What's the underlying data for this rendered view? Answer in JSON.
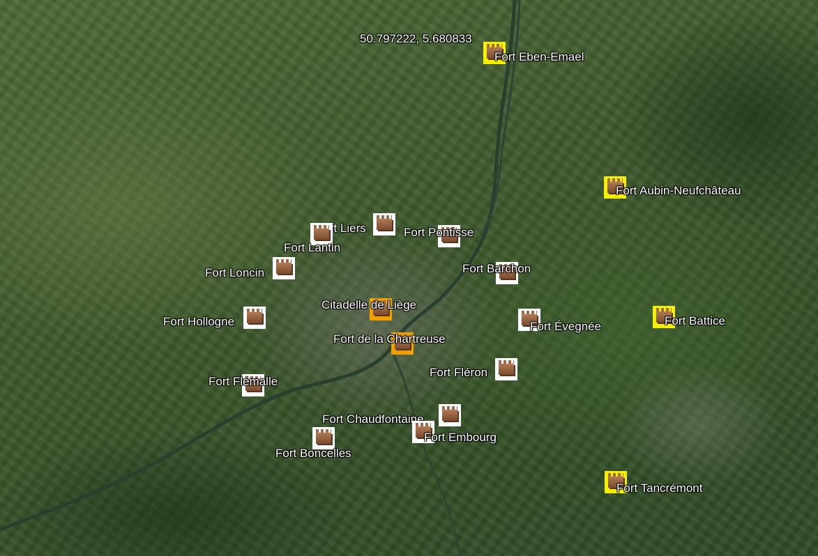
{
  "map": {
    "type": "satellite",
    "coordinate_readout": "50.797222, 5.680833"
  },
  "colors": {
    "fort_icon_white": "#ffffff",
    "fort_icon_yellow": "#f5f000",
    "fort_icon_orange": "#f0a000",
    "label": "#ffffff"
  },
  "placemarks": [
    {
      "name": "Fort Eben-Emael",
      "icon": "fort-icon",
      "style": "yellow"
    },
    {
      "name": "Fort Aubin-Neufchâteau",
      "icon": "fort-icon",
      "style": "yellow"
    },
    {
      "name": "Fort Liers",
      "icon": "fort-icon",
      "style": "white"
    },
    {
      "name": "Fort Pontisse",
      "icon": "fort-icon",
      "style": "white"
    },
    {
      "name": "Fort Lantin",
      "icon": "fort-icon",
      "style": "white"
    },
    {
      "name": "Fort Loncin",
      "icon": "fort-icon",
      "style": "white"
    },
    {
      "name": "Fort Barchon",
      "icon": "fort-icon",
      "style": "white"
    },
    {
      "name": "Citadelle de Liège",
      "icon": "fort-icon",
      "style": "orange"
    },
    {
      "name": "Fort Hollogne",
      "icon": "fort-icon",
      "style": "white"
    },
    {
      "name": "Fort Évegnée",
      "icon": "fort-icon",
      "style": "white"
    },
    {
      "name": "Fort Battice",
      "icon": "fort-icon",
      "style": "yellow"
    },
    {
      "name": "Fort de la Chartreuse",
      "icon": "fort-icon",
      "style": "orange"
    },
    {
      "name": "Fort Fléron",
      "icon": "fort-icon",
      "style": "white"
    },
    {
      "name": "Fort Flémalle",
      "icon": "fort-icon",
      "style": "white"
    },
    {
      "name": "Fort Chaudfontaine",
      "icon": "fort-icon",
      "style": "white"
    },
    {
      "name": "Fort Embourg",
      "icon": "fort-icon",
      "style": "white"
    },
    {
      "name": "Fort Boncelles",
      "icon": "fort-icon",
      "style": "white"
    },
    {
      "name": "Fort Tancrémont",
      "icon": "fort-icon",
      "style": "yellow"
    }
  ]
}
